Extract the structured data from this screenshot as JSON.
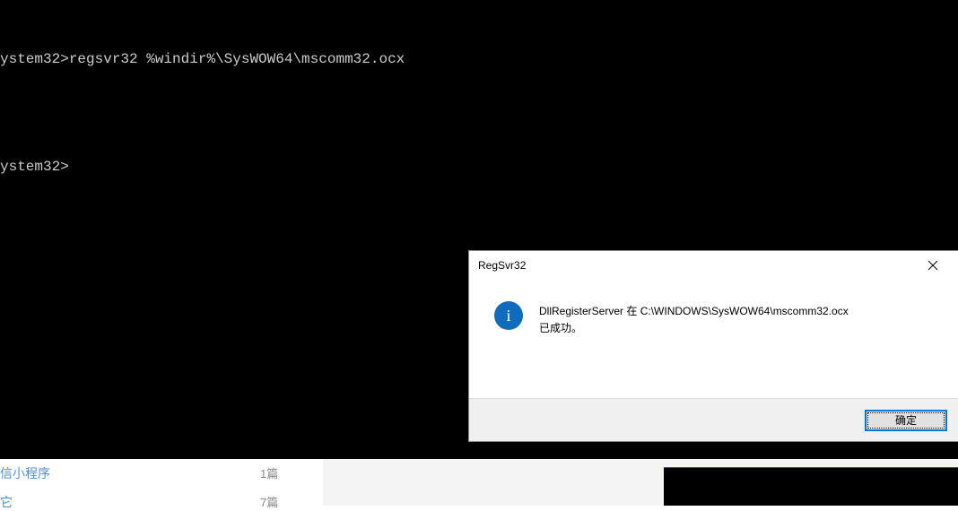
{
  "terminal": {
    "line1": "ystem32>regsvr32 %windir%\\SysWOW64\\mscomm32.ocx",
    "line2": "",
    "line3": "ystem32>"
  },
  "dialog": {
    "title": "RegSvr32",
    "icon_glyph": "i",
    "message_line1": "DllRegisterServer 在 C:\\WINDOWS\\SysWOW64\\mscomm32.ocx",
    "message_line2": "已成功。",
    "ok_button": "确定"
  },
  "sidebar": {
    "items": [
      {
        "label": "信小程序",
        "count": "1篇"
      },
      {
        "label": "它",
        "count": "7篇"
      }
    ]
  }
}
